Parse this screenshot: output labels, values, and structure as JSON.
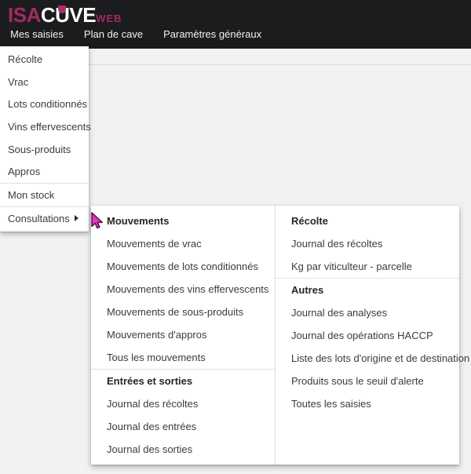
{
  "header": {
    "logo": {
      "isa": "ISA",
      "c": "C",
      "u": "U",
      "ve": "VE",
      "web": "WEB"
    },
    "nav_items": [
      {
        "label": "Mes saisies"
      },
      {
        "label": "Plan de cave"
      },
      {
        "label": "Paramètres généraux"
      }
    ]
  },
  "main_menu": {
    "items": [
      "Récolte",
      "Vrac",
      "Lots conditionnés",
      "Vins effervescents",
      "Sous-produits",
      "Appros",
      "Mon stock",
      "Consultations"
    ]
  },
  "submenu": {
    "left_column": {
      "sections": [
        {
          "title": "Mouvements",
          "items": [
            "Mouvements de vrac",
            "Mouvements de lots conditionnés",
            "Mouvements des vins effervescents",
            "Mouvements de sous-produits",
            "Mouvements d'appros",
            "Tous les mouvements"
          ]
        },
        {
          "title": "Entrées et sorties",
          "items": [
            "Journal des récoltes",
            "Journal des entrées",
            "Journal des sorties"
          ]
        }
      ]
    },
    "right_column": {
      "sections": [
        {
          "title": "Récolte",
          "items": [
            "Journal des récoltes",
            "Kg par viticulteur - parcelle"
          ]
        },
        {
          "title": "Autres",
          "items": [
            "Journal des analyses",
            "Journal des opérations HACCP",
            "Liste des lots d'origine et de destination",
            "Produits sous le seuil d'alerte",
            "Toutes les saisies"
          ]
        }
      ]
    }
  },
  "colors": {
    "brand_pink": "#a32a63",
    "nav_background": "#1b1c1e",
    "cursor_pink": "#e335bd"
  }
}
